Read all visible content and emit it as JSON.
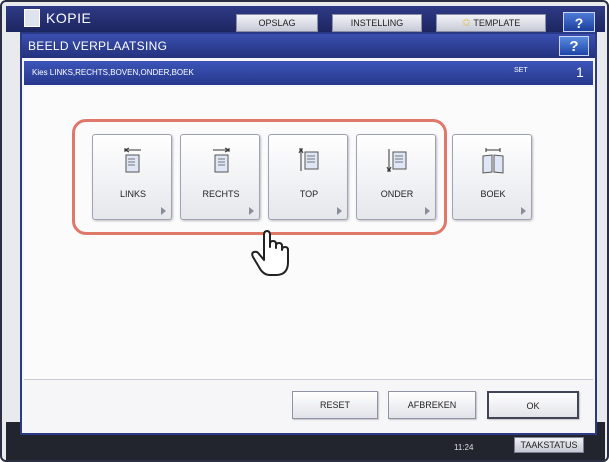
{
  "app": {
    "title": "KOPIE",
    "tabs": [
      "OPSLAG",
      "INSTELLING",
      "TEMPLATE"
    ],
    "help": "?"
  },
  "dialog": {
    "title": "BEELD VERPLAATSING",
    "help": "?",
    "instruction": "Kies LINKS,RECHTS,BOVEN,ONDER,BOEK",
    "set_label": "SET",
    "set_count": "1"
  },
  "shift_options": [
    {
      "label": "LINKS",
      "icon": "shift-left-icon"
    },
    {
      "label": "RECHTS",
      "icon": "shift-right-icon"
    },
    {
      "label": "TOP",
      "icon": "shift-top-icon"
    },
    {
      "label": "ONDER",
      "icon": "shift-bottom-icon"
    },
    {
      "label": "BOEK",
      "icon": "book-icon"
    }
  ],
  "actions": {
    "reset": "RESET",
    "cancel": "AFBREKEN",
    "ok": "OK"
  },
  "status_bar": {
    "time": "11:24",
    "job_status": "TAAKSTATUS"
  },
  "colors": {
    "title_bar": "#2b3a86",
    "highlight": "#e0786a",
    "bottom_bar": "#23252e"
  }
}
